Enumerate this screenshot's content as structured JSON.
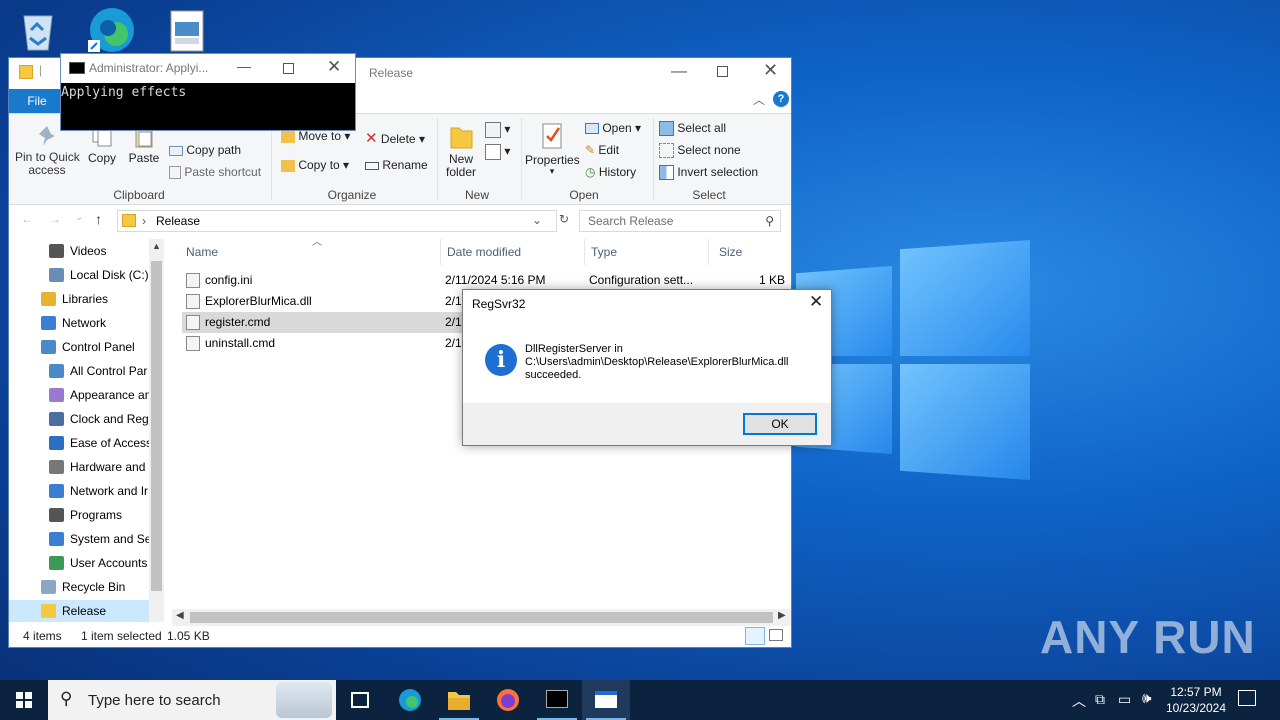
{
  "explorer": {
    "title": "Release",
    "file_tab": "File",
    "ribbon": {
      "clipboard": {
        "label": "Clipboard",
        "pin": "Pin to Quick\naccess",
        "copy": "Copy",
        "paste": "Paste",
        "copy_path": "Copy path",
        "paste_shortcut": "Paste shortcut"
      },
      "organize": {
        "label": "Organize",
        "move_to": "Move to",
        "copy_to": "Copy to",
        "delete": "Delete",
        "rename": "Rename"
      },
      "new": {
        "label": "New",
        "new_folder": "New\nfolder"
      },
      "open": {
        "label": "Open",
        "properties": "Properties",
        "open": "Open",
        "edit": "Edit",
        "history": "History"
      },
      "select": {
        "label": "Select",
        "select_all": "Select all",
        "select_none": "Select none",
        "invert": "Invert selection"
      }
    },
    "address": "Release",
    "search_placeholder": "Search Release",
    "nav": [
      {
        "label": "Videos",
        "icon": "videos-icon"
      },
      {
        "label": "Local Disk (C:)",
        "icon": "drive-icon"
      },
      {
        "label": "Libraries",
        "icon": "libraries-icon"
      },
      {
        "label": "Network",
        "icon": "network-icon"
      },
      {
        "label": "Control Panel",
        "icon": "control-panel-icon"
      },
      {
        "label": "All Control Par",
        "icon": "control-panel-icon"
      },
      {
        "label": "Appearance an",
        "icon": "appearance-icon"
      },
      {
        "label": "Clock and Regi",
        "icon": "clock-icon"
      },
      {
        "label": "Ease of Access",
        "icon": "ease-access-icon"
      },
      {
        "label": "Hardware and",
        "icon": "hardware-icon"
      },
      {
        "label": "Network and Ir",
        "icon": "network-icon"
      },
      {
        "label": "Programs",
        "icon": "programs-icon"
      },
      {
        "label": "System and Sec",
        "icon": "shield-icon"
      },
      {
        "label": "User Accounts",
        "icon": "users-icon"
      },
      {
        "label": "Recycle Bin",
        "icon": "recycle-bin-icon"
      },
      {
        "label": "Release",
        "icon": "folder-icon"
      }
    ],
    "columns": {
      "name": "Name",
      "date": "Date modified",
      "type": "Type",
      "size": "Size"
    },
    "files": [
      {
        "name": "config.ini",
        "date": "2/11/2024 5:16 PM",
        "type": "Configuration sett...",
        "size": "1 KB"
      },
      {
        "name": "ExplorerBlurMica.dll",
        "date": "2/1",
        "type": "",
        "size": ""
      },
      {
        "name": "register.cmd",
        "date": "2/1",
        "type": "",
        "size": ""
      },
      {
        "name": "uninstall.cmd",
        "date": "2/1",
        "type": "",
        "size": ""
      }
    ],
    "status": {
      "items": "4 items",
      "selected": "1 item selected",
      "size": "1.05 KB"
    }
  },
  "console": {
    "title": "Administrator: Applyi...",
    "output": "Applying effects"
  },
  "dialog": {
    "title": "RegSvr32",
    "line1": "DllRegisterServer in",
    "line2": "C:\\Users\\admin\\Desktop\\Release\\ExplorerBlurMica.dll",
    "line3": "succeeded.",
    "ok": "OK"
  },
  "taskbar": {
    "search_placeholder": "Type here to search",
    "time": "12:57 PM",
    "date": "10/23/2024"
  },
  "watermark": "ANY RUN"
}
